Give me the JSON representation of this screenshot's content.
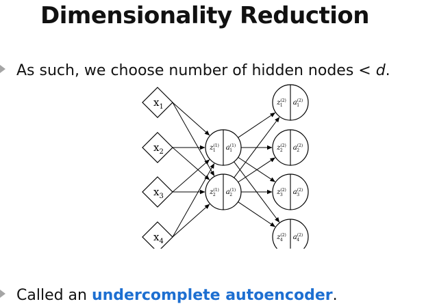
{
  "title": "Dimensionality Reduction",
  "bullet1": {
    "text": "As such, we choose number of hidden nodes < ",
    "emph": "d",
    "end": "."
  },
  "bullet2": {
    "prefix": "Called an ",
    "highlight": "undercomplete autoencoder",
    "suffix": "."
  },
  "colors": {
    "highlight": "#1d6fd1",
    "bullet": "#a5a5a5"
  },
  "network": {
    "inputs": [
      {
        "label": "x",
        "sub": "1"
      },
      {
        "label": "x",
        "sub": "2"
      },
      {
        "label": "x",
        "sub": "3"
      },
      {
        "label": "x",
        "sub": "4"
      }
    ],
    "hidden": [
      {
        "z": "z",
        "z_sub": "1",
        "z_sup": "(1)",
        "a": "a",
        "a_sub": "1",
        "a_sup": "(1)"
      },
      {
        "z": "z",
        "z_sub": "2",
        "z_sup": "(1)",
        "a": "a",
        "a_sub": "2",
        "a_sup": "(1)"
      }
    ],
    "outputs": [
      {
        "z": "z",
        "z_sub": "1",
        "z_sup": "(2)",
        "a": "a",
        "a_sub": "1",
        "a_sup": "(2)"
      },
      {
        "z": "z",
        "z_sub": "2",
        "z_sup": "(2)",
        "a": "a",
        "a_sub": "2",
        "a_sup": "(2)"
      },
      {
        "z": "z",
        "z_sub": "3",
        "z_sup": "(2)",
        "a": "a",
        "a_sub": "3",
        "a_sup": "(2)"
      },
      {
        "z": "z",
        "z_sub": "4",
        "z_sup": "(2)",
        "a": "a",
        "a_sub": "4",
        "a_sup": "(2)"
      }
    ]
  }
}
